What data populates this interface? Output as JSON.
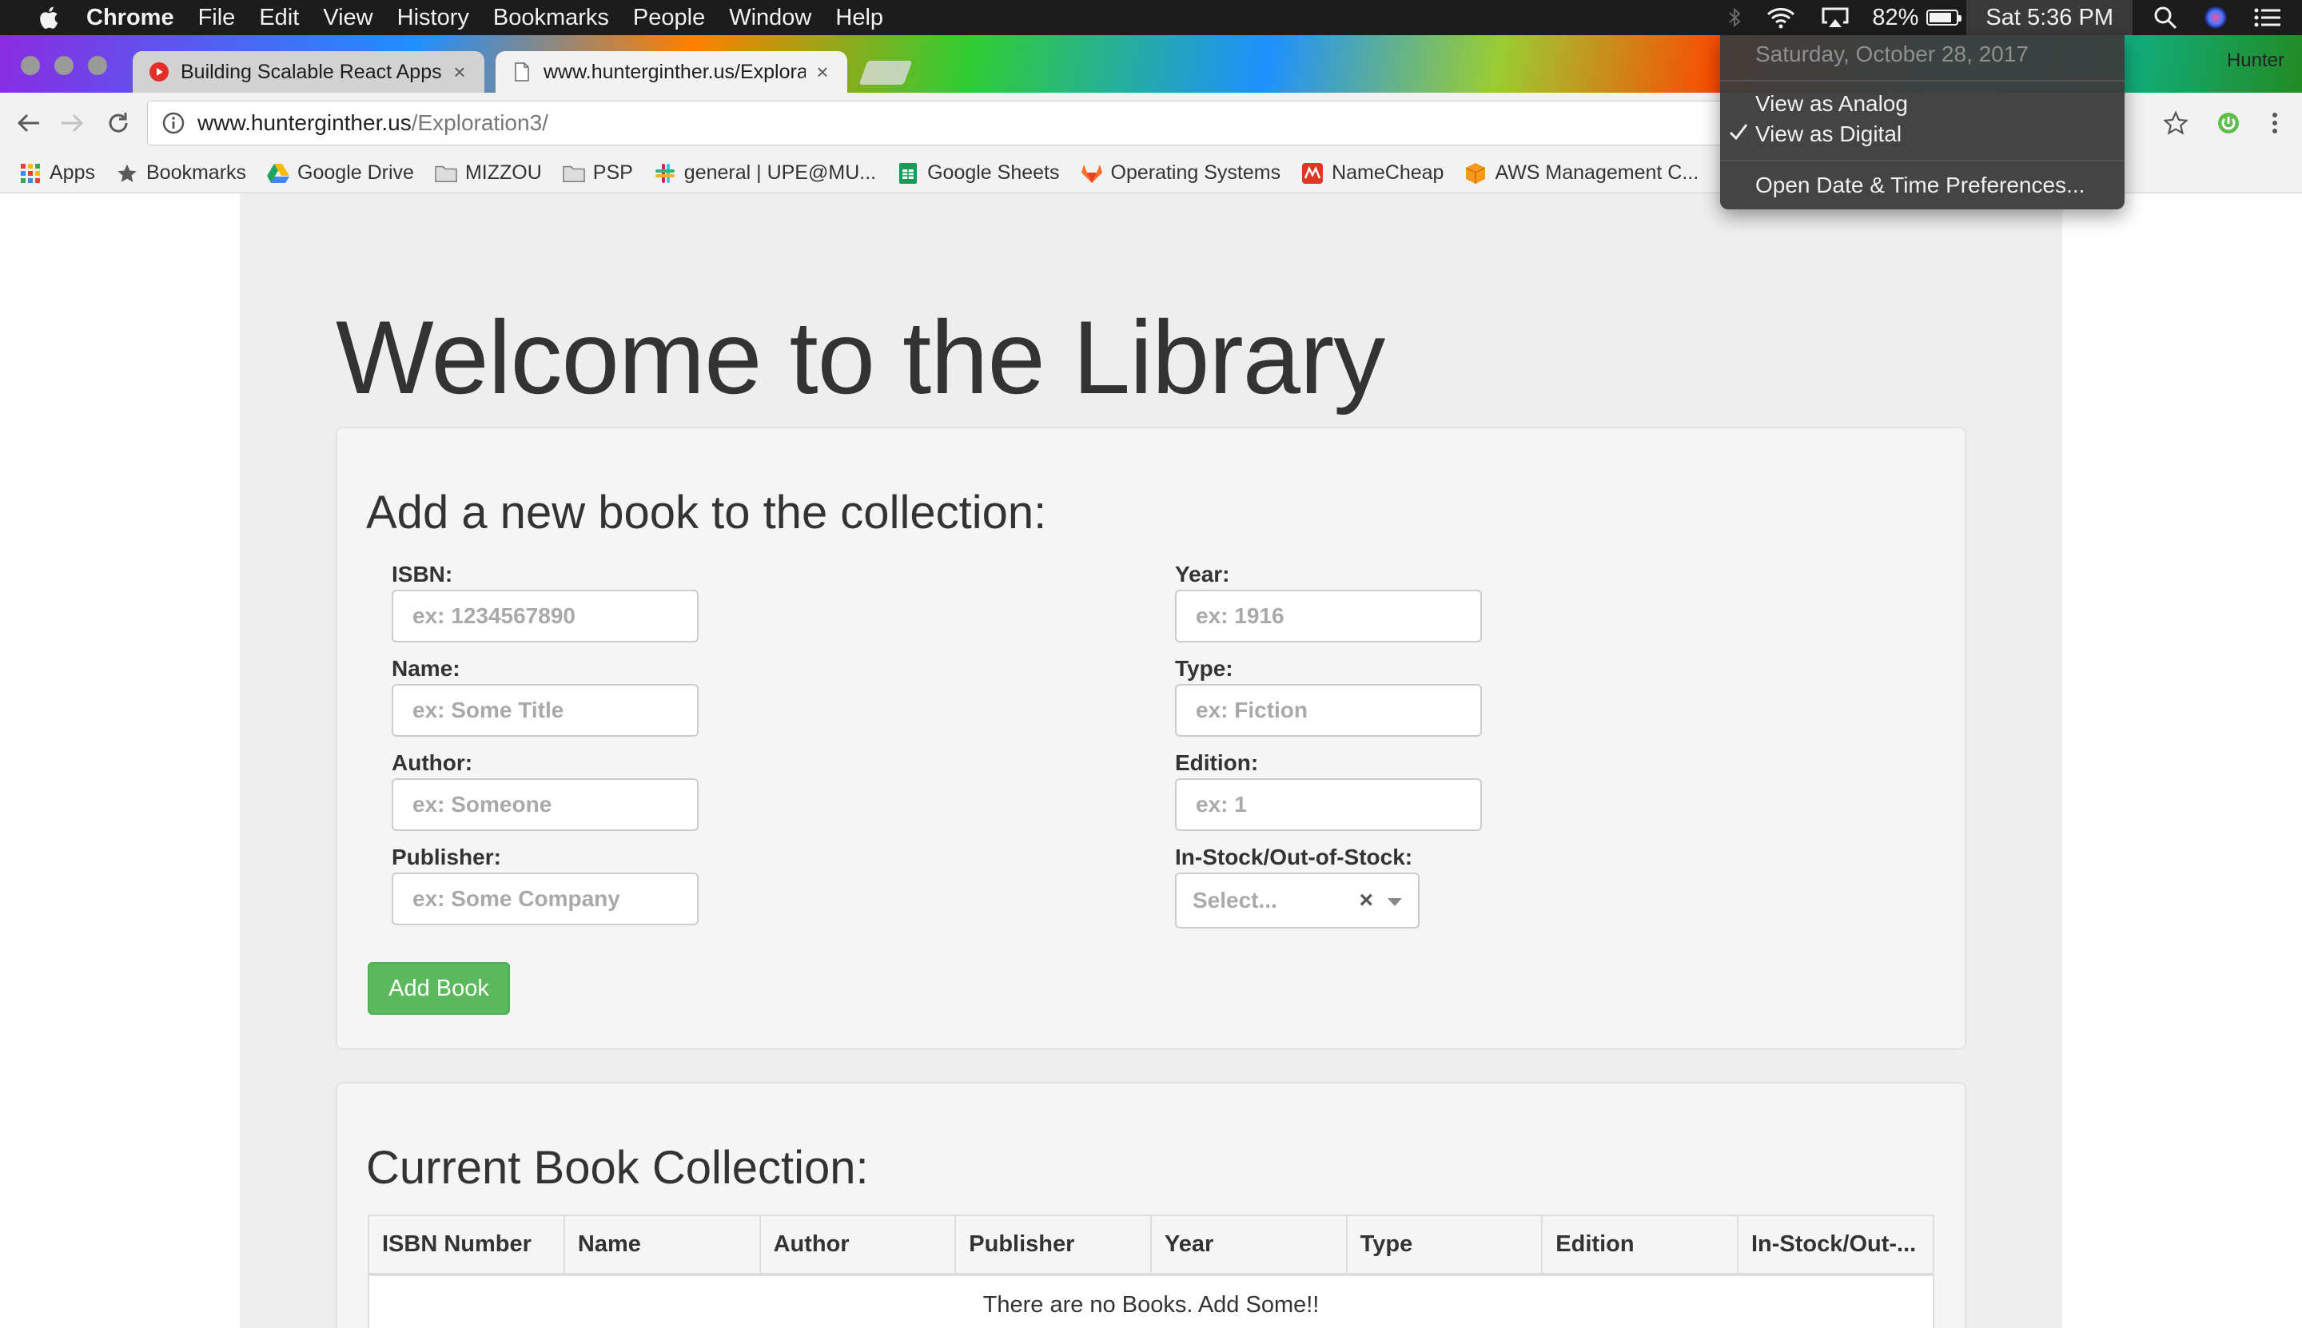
{
  "menubar": {
    "app": "Chrome",
    "items": [
      "File",
      "Edit",
      "View",
      "History",
      "Bookmarks",
      "People",
      "Window",
      "Help"
    ],
    "battery": "82%",
    "battery_level": 0.82,
    "clock": "Sat 5:36 PM"
  },
  "clock_menu": {
    "date": "Saturday, October 28, 2017",
    "analog": "View as Analog",
    "digital": "View as Digital",
    "checked": "digital",
    "prefs": "Open Date & Time Preferences..."
  },
  "tabs": [
    {
      "title": "Building Scalable React Apps |"
    },
    {
      "title": "www.hunterginther.us/Explorat"
    }
  ],
  "profile": "Hunter",
  "address": {
    "host": "www.hunterginther.us",
    "path": "/Exploration3/"
  },
  "bookmarks": [
    {
      "label": "Apps",
      "icon": "apps-grid-icon"
    },
    {
      "label": "Bookmarks",
      "icon": "star-icon"
    },
    {
      "label": "Google Drive",
      "icon": "google-drive-icon"
    },
    {
      "label": "MIZZOU",
      "icon": "folder-icon"
    },
    {
      "label": "PSP",
      "icon": "folder-icon"
    },
    {
      "label": "general | UPE@MU...",
      "icon": "slack-icon"
    },
    {
      "label": "Google Sheets",
      "icon": "google-sheets-icon"
    },
    {
      "label": "Operating Systems",
      "icon": "gitlab-icon"
    },
    {
      "label": "NameCheap",
      "icon": "namecheap-icon"
    },
    {
      "label": "AWS Management C...",
      "icon": "aws-icon"
    }
  ],
  "page": {
    "title": "Welcome to the Library",
    "form": {
      "heading": "Add a new book to the collection:",
      "isbn": {
        "label": "ISBN:",
        "placeholder": "ex: 1234567890"
      },
      "name": {
        "label": "Name:",
        "placeholder": "ex: Some Title"
      },
      "author": {
        "label": "Author:",
        "placeholder": "ex: Someone"
      },
      "publisher": {
        "label": "Publisher:",
        "placeholder": "ex: Some Company"
      },
      "year": {
        "label": "Year:",
        "placeholder": "ex: 1916"
      },
      "type": {
        "label": "Type:",
        "placeholder": "ex: Fiction"
      },
      "edition": {
        "label": "Edition:",
        "placeholder": "ex: 1"
      },
      "stock": {
        "label": "In-Stock/Out-of-Stock:",
        "placeholder": "Select..."
      },
      "submit": "Add Book"
    },
    "collection": {
      "heading": "Current Book Collection:",
      "columns": [
        "ISBN Number",
        "Name",
        "Author",
        "Publisher",
        "Year",
        "Type",
        "Edition",
        "In-Stock/Out-..."
      ],
      "empty": "There are no Books. Add Some!!"
    }
  }
}
